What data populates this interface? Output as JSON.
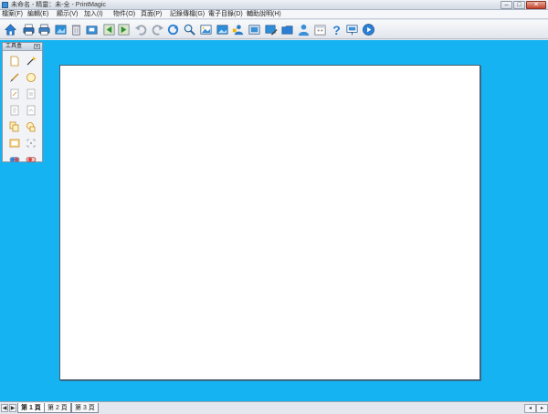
{
  "window": {
    "title": "未命名 - 精靈：未-全 - PrintMagic",
    "controls": {
      "minimize": "–",
      "maximize": "□",
      "close": "✕"
    }
  },
  "menu": {
    "items": [
      {
        "label": "檔案(F)"
      },
      {
        "label": "編輯(E)"
      },
      {
        "label": "顯示(V)"
      },
      {
        "label": "加入(I)"
      },
      {
        "label": "物件(O)"
      },
      {
        "label": "頁面(P)"
      },
      {
        "label": "記錄傳檔(G)"
      },
      {
        "label": "電子目錄(D)"
      },
      {
        "label": "輔助說明(H)"
      }
    ]
  },
  "toolbar": {
    "buttons": [
      {
        "icon": "home-icon"
      },
      {
        "icon": "print-icon"
      },
      {
        "icon": "printer-icon"
      },
      {
        "icon": "image-settings-icon"
      },
      {
        "icon": "trash-icon"
      },
      {
        "icon": "slide-icon"
      },
      {
        "icon": "previous-page-icon"
      },
      {
        "icon": "next-page-icon"
      },
      {
        "icon": "undo-icon"
      },
      {
        "icon": "redo-icon"
      },
      {
        "icon": "rotate-icon"
      },
      {
        "icon": "zoom-icon"
      },
      {
        "icon": "edit-image-icon"
      },
      {
        "icon": "picture-icon"
      },
      {
        "icon": "user-group-icon"
      },
      {
        "icon": "photo-frame-icon"
      },
      {
        "icon": "photo-edit-icon"
      },
      {
        "icon": "folder-icon"
      },
      {
        "icon": "person-icon"
      },
      {
        "icon": "calendar-icon"
      },
      {
        "icon": "help-icon"
      },
      {
        "icon": "presentation-icon"
      },
      {
        "icon": "play-icon"
      }
    ]
  },
  "toolbox": {
    "title": "工具盒",
    "close_label": "x",
    "tools": [
      {
        "icon": "new-page-icon"
      },
      {
        "icon": "wand-icon"
      },
      {
        "icon": "brush-icon"
      },
      {
        "icon": "circle-icon"
      },
      {
        "icon": "page-a-icon"
      },
      {
        "icon": "page-b-icon"
      },
      {
        "icon": "page-c-icon"
      },
      {
        "icon": "page-d-icon"
      },
      {
        "icon": "copy-icon"
      },
      {
        "icon": "shapes-icon"
      },
      {
        "icon": "frame-icon"
      },
      {
        "icon": "grid-icon"
      },
      {
        "icon": "toggle-blue-icon"
      },
      {
        "icon": "toggle-red-icon"
      }
    ]
  },
  "pages": {
    "tabs": [
      {
        "label": "第 1 頁",
        "active": true
      },
      {
        "label": "第 2 頁",
        "active": false
      },
      {
        "label": "第 3 頁",
        "active": false
      }
    ],
    "nav_prev": "◀",
    "nav_next": "▶"
  },
  "colors": {
    "workspace": "#15b3f2",
    "canvas": "#ffffff",
    "accent": "#2a7fd4"
  }
}
